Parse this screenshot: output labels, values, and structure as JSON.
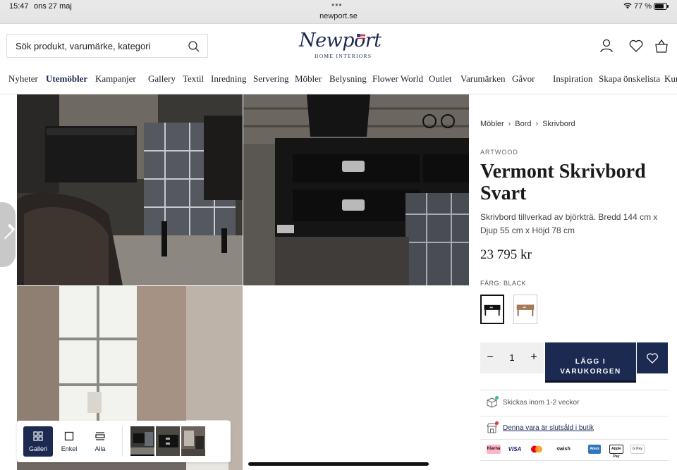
{
  "status_bar": {
    "time": "15:47",
    "date": "ons 27 maj",
    "url": "newport.se",
    "battery": "77 %",
    "dots": "•••"
  },
  "header": {
    "search_placeholder": "Sök produkt, varumärke, kategori",
    "logo_text": "Newport",
    "logo_sub": "HOME INTERIORS"
  },
  "nav": [
    "Nyheter",
    "Utemöbler",
    "Kampanjer",
    "Gallery",
    "Textil",
    "Inredning",
    "Servering",
    "Möbler",
    "Belysning",
    "Flower World",
    "Outlet",
    "Varumärken",
    "Gåvor",
    "Inspiration",
    "Skapa önskelista",
    "Kun"
  ],
  "gallery": {
    "views": [
      {
        "label": "Galleri",
        "icon": "grid-icon",
        "active": true
      },
      {
        "label": "Enkel",
        "icon": "square-icon",
        "active": false
      },
      {
        "label": "Alla",
        "icon": "list-icon",
        "active": false
      }
    ]
  },
  "product": {
    "breadcrumb": [
      "Möbler",
      "Bord",
      "Skrivbord"
    ],
    "brand": "ARTWOOD",
    "title": "Vermont Skrivbord Svart",
    "description": "Skrivbord tillverkad av björkträ. Bredd 144 cm x Djup 55 cm x Höjd 78 cm",
    "price": "23 795 kr",
    "color_label": "FÄRG: BLACK",
    "quantity": "1",
    "qty_minus": "−",
    "qty_plus": "+",
    "add_to_cart": "LÄGG I VARUKORGEN",
    "shipping": "Skickas inom 1-2 veckor",
    "store_status": "Denna vara är slutsåld i butik",
    "payments": [
      "Klarna",
      "VISA",
      "Mastercard",
      "swish",
      "Amex",
      "Apple Pay",
      "G Pay"
    ]
  },
  "colors": {
    "brand_navy": "#1c2a52",
    "in_stock": "#3fbf7f",
    "sold_out": "#e03a3a"
  }
}
